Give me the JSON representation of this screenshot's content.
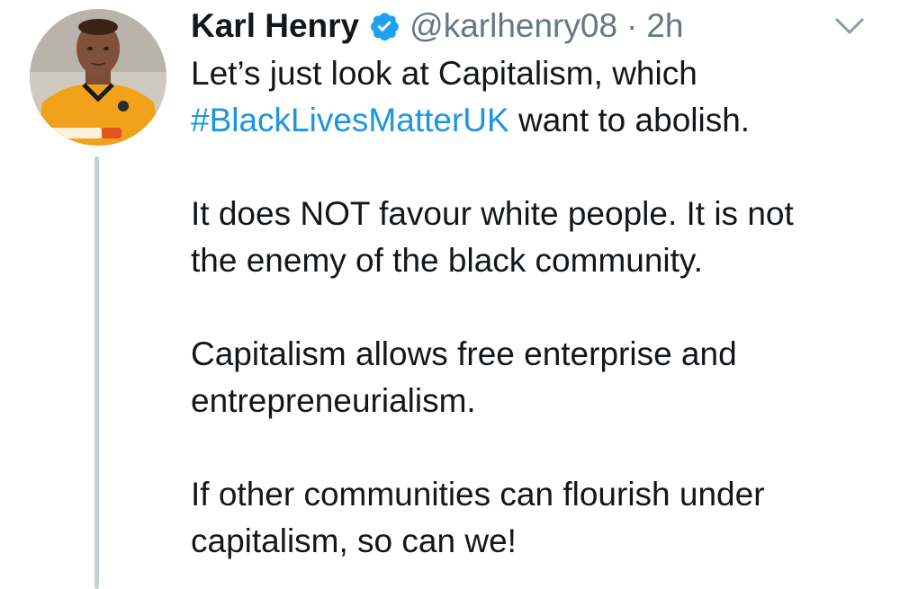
{
  "tweet": {
    "author_name": "Karl Henry",
    "handle": "@karlhenry08",
    "separator": "·",
    "timestamp": "2h",
    "verified_icon": "verified-badge-icon",
    "menu_icon": "chevron-down-icon",
    "line1": "Let’s just look at Capitalism, which",
    "hashtag": "#BlackLivesMatterUK",
    "line2_rest": " want to abolish.",
    "para2_line1": "It does NOT favour white people. It is not",
    "para2_line2": "the enemy of the black community.",
    "para3_line1": "Capitalism allows free enterprise and",
    "para3_line2": "entrepreneurialism.",
    "para4_line1": "If other communities can flourish under",
    "para4_line2": "capitalism, so can we!"
  },
  "colors": {
    "hashtag": "#1b95e0",
    "verified": "#1da1f2",
    "muted_text": "#657786",
    "thread_line": "#c4cfd6"
  }
}
